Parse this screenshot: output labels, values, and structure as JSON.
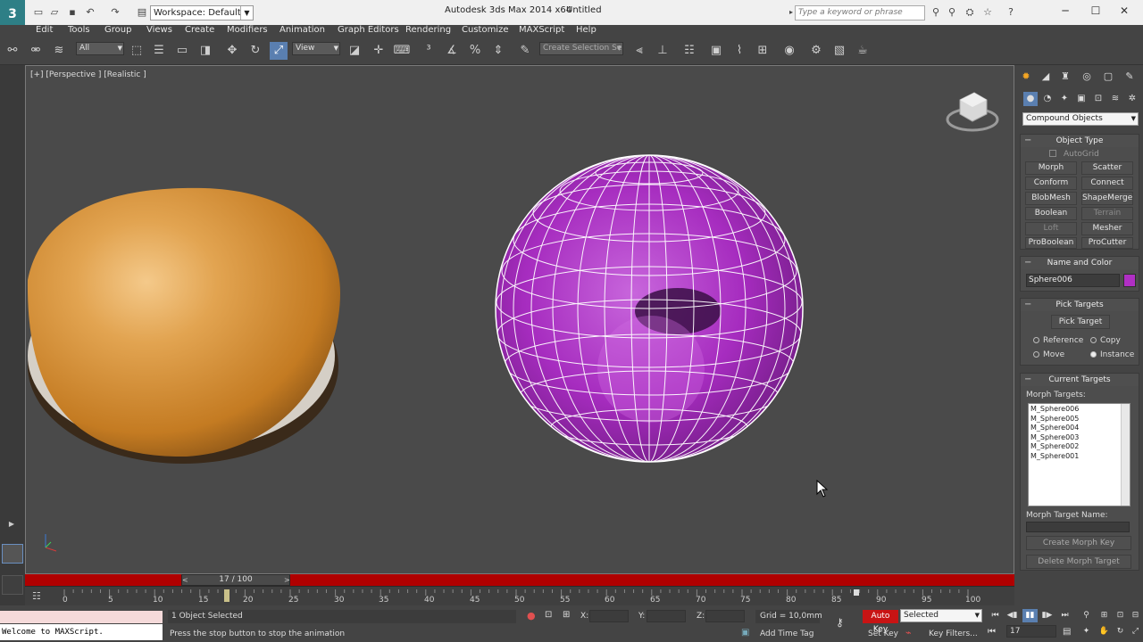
{
  "titlebar": {
    "workspace": "Workspace: Default",
    "app_title": "Autodesk 3ds Max  2014 x64",
    "doc_title": "Untitled",
    "search_placeholder": "Type a keyword or phrase",
    "logo": "3"
  },
  "menu": [
    "Edit",
    "Tools",
    "Group",
    "Views",
    "Create",
    "Modifiers",
    "Animation",
    "Graph Editors",
    "Rendering",
    "Customize",
    "MAXScript",
    "Help"
  ],
  "toolbar": {
    "selection_filter": "All",
    "ref_coord": "View",
    "named_selection": "Create Selection Se"
  },
  "viewport": {
    "label": "[+] [Perspective ] [Realistic ]",
    "orange_color": "#d18a2e",
    "purple_color": "#b02fc4"
  },
  "panel": {
    "category": "Compound Objects",
    "object_type": {
      "title": "Object Type",
      "autogrid": "AutoGrid",
      "buttons": [
        "Morph",
        "Scatter",
        "Conform",
        "Connect",
        "BlobMesh",
        "ShapeMerge",
        "Boolean",
        "Terrain",
        "Loft",
        "Mesher",
        "ProBoolean",
        "ProCutter"
      ]
    },
    "name_color": {
      "title": "Name and Color",
      "name": "Sphere006",
      "swatch": "#b02fc4"
    },
    "pick_targets": {
      "title": "Pick Targets",
      "button": "Pick Target",
      "options": [
        "Reference",
        "Copy",
        "Move",
        "Instance"
      ]
    },
    "current_targets": {
      "title": "Current Targets",
      "list_label": "Morph Targets:",
      "items": [
        "M_Sphere006",
        "M_Sphere005",
        "M_Sphere004",
        "M_Sphere003",
        "M_Sphere002",
        "M_Sphere001"
      ],
      "name_label": "Morph Target Name:",
      "create_key": "Create Morph Key",
      "delete_target": "Delete Morph Target"
    }
  },
  "timeline": {
    "frame_label": "17 / 100",
    "ticks": [
      "0",
      "5",
      "10",
      "15",
      "20",
      "25",
      "30",
      "35",
      "40",
      "45",
      "50",
      "55",
      "60",
      "65",
      "70",
      "75",
      "80",
      "85",
      "90",
      "95",
      "100"
    ]
  },
  "status": {
    "maxscript": "Welcome to MAXScript.",
    "selected": "1 Object Selected",
    "prompt": "Press the stop button to stop the animation",
    "x_label": "X:",
    "y_label": "Y:",
    "z_label": "Z:",
    "grid": "Grid = 10,0mm",
    "add_time_tag": "Add Time Tag",
    "auto_key": "Auto Key",
    "set_key": "Set Key",
    "selected_drop": "Selected",
    "key_filters": "Key Filters...",
    "current_frame": "17"
  }
}
